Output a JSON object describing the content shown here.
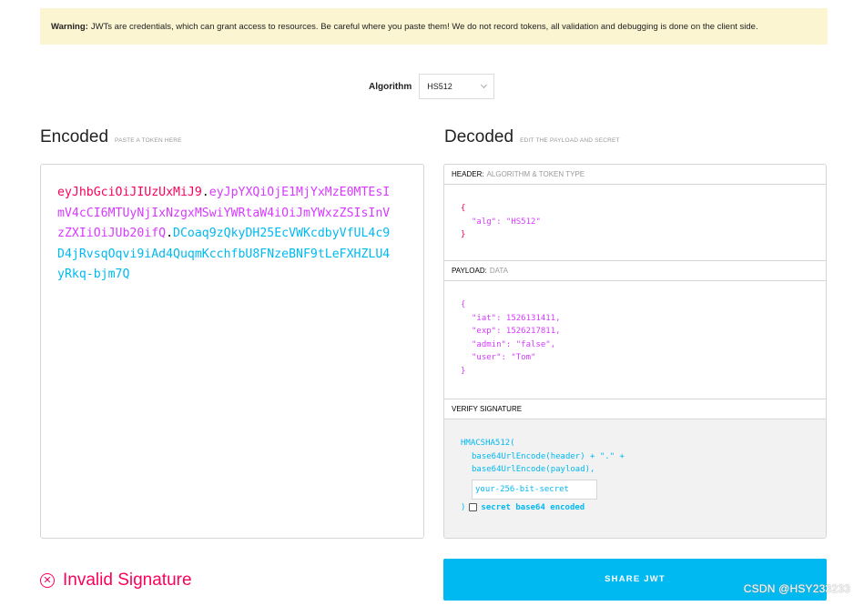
{
  "warning": {
    "bold": "Warning:",
    "text": "JWTs are credentials, which can grant access to resources. Be careful where you paste them! We do not record tokens, all validation and debugging is done on the client side."
  },
  "algorithm": {
    "label": "Algorithm",
    "value": "HS512"
  },
  "encoded": {
    "title": "Encoded",
    "subtitle": "PASTE A TOKEN HERE",
    "token_header": "eyJhbGciOiJIUzUxMiJ9",
    "token_payload": "eyJpYXQiOjE1MjYxMzE0MTEsImV4cCI6MTUyNjIxNzgxMSwiYWRtaW4iOiJmYWxzZSIsInVzZXIiOiJUb20ifQ",
    "token_signature": "DCoaq9zQkyDH25EcVWKcdbyVfUL4c9D4jRvsqOqvi9iAd4QuqmKcchfbU8FNzeBNF9tLeFXHZLU4yRkq-bjm7Q",
    "dot": "."
  },
  "decoded": {
    "title": "Decoded",
    "subtitle": "EDIT THE PAYLOAD AND SECRET",
    "header": {
      "label": "HEADER:",
      "label_muted": "ALGORITHM & TOKEN TYPE",
      "open": "{",
      "close": "}",
      "line": "\"alg\": \"HS512\""
    },
    "payload": {
      "label": "PAYLOAD:",
      "label_muted": "DATA",
      "open": "{",
      "close": "}",
      "lines": [
        "\"iat\": 1526131411,",
        "\"exp\": 1526217811,",
        "\"admin\": \"false\",",
        "\"user\": \"Tom\""
      ]
    },
    "verify": {
      "label": "VERIFY SIGNATURE",
      "fn": "HMACSHA512(",
      "line1": "base64UrlEncode(header) + \".\" +",
      "line2": "base64UrlEncode(payload),",
      "secret_placeholder": "your-256-bit-secret",
      "close": ")",
      "checkbox_label": "secret base64 encoded"
    }
  },
  "status": {
    "icon": "⊗",
    "text": "Invalid Signature"
  },
  "share_button": "SHARE JWT",
  "watermark": "CSDN @HSY233233"
}
